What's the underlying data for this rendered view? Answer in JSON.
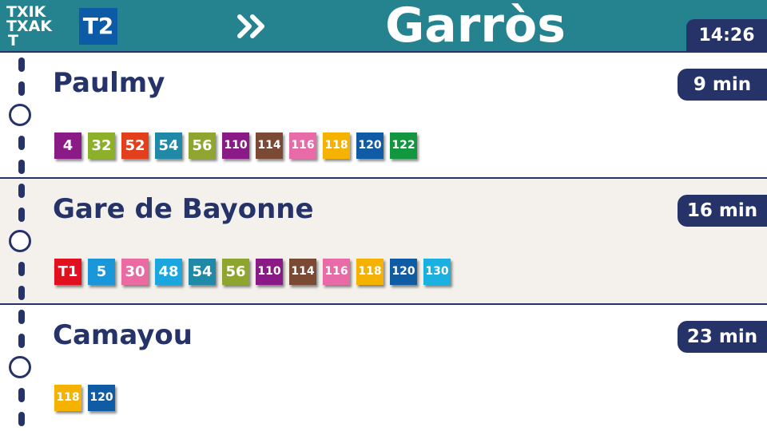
{
  "header": {
    "logo_lines": [
      "TXIK",
      "TXAK",
      "T"
    ],
    "line": "T2",
    "line_color": "#0d5aa7",
    "direction_icon": "double-chevron-right",
    "destination": "Garròs",
    "time": "14:26",
    "bg_color": "#24838f"
  },
  "stops": [
    {
      "name": "Paulmy",
      "eta": "9 min",
      "lines": [
        {
          "label": "4",
          "color": "#8a1a85"
        },
        {
          "label": "32",
          "color": "#8db02b"
        },
        {
          "label": "52",
          "color": "#e2401c"
        },
        {
          "label": "54",
          "color": "#2189a8"
        },
        {
          "label": "56",
          "color": "#8ea630"
        },
        {
          "label": "110",
          "color": "#8a1a85"
        },
        {
          "label": "114",
          "color": "#7a4a35"
        },
        {
          "label": "116",
          "color": "#e86aa6"
        },
        {
          "label": "118",
          "color": "#f5b200"
        },
        {
          "label": "120",
          "color": "#0f5ca4"
        },
        {
          "label": "122",
          "color": "#12963f"
        }
      ]
    },
    {
      "name": "Gare de Bayonne",
      "eta": "16 min",
      "lines": [
        {
          "label": "T1",
          "color": "#e1101f"
        },
        {
          "label": "5",
          "color": "#1a97d8"
        },
        {
          "label": "30",
          "color": "#ea6aa2"
        },
        {
          "label": "48",
          "color": "#1ca6e0"
        },
        {
          "label": "54",
          "color": "#2189a8"
        },
        {
          "label": "56",
          "color": "#8ea630"
        },
        {
          "label": "110",
          "color": "#8a1a85"
        },
        {
          "label": "114",
          "color": "#7a4a35"
        },
        {
          "label": "116",
          "color": "#e86aa6"
        },
        {
          "label": "118",
          "color": "#f5b200"
        },
        {
          "label": "120",
          "color": "#0f5ca4"
        },
        {
          "label": "130",
          "color": "#1ab0e0"
        }
      ]
    },
    {
      "name": "Camayou",
      "eta": "23 min",
      "lines": [
        {
          "label": "118",
          "color": "#f5b200"
        },
        {
          "label": "120",
          "color": "#0f5ca4"
        }
      ]
    }
  ]
}
